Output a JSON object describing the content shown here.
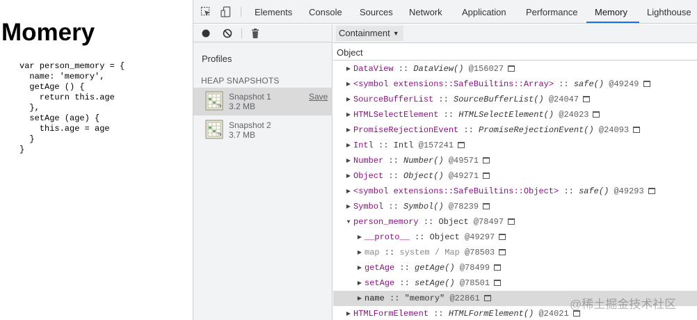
{
  "page": {
    "title": "Momery",
    "code_lines": [
      "var person_memory = {",
      "  name: 'memory',",
      "  getAge () {",
      "    return this.age",
      "  },",
      "  setAge (age) {",
      "    this.age = age",
      "  }",
      "}"
    ]
  },
  "devtools": {
    "toolbar_icons": [
      "inspect-element-icon",
      "device-toolbar-icon"
    ],
    "tabs": [
      {
        "label": "Elements",
        "active": false
      },
      {
        "label": "Console",
        "active": false
      },
      {
        "label": "Sources",
        "active": false
      },
      {
        "label": "Network",
        "active": false
      },
      {
        "label": "Application",
        "active": false
      },
      {
        "label": "Performance",
        "active": false
      },
      {
        "label": "Memory",
        "active": true
      },
      {
        "label": "Lighthouse",
        "active": false
      }
    ],
    "accent_color": "#1a73e8"
  },
  "profiles": {
    "tool_icons": [
      "record-icon",
      "clear-icon",
      "garbage-collect-icon"
    ],
    "heading": "Profiles",
    "section_heading": "HEAP SNAPSHOTS",
    "save_label": "Save",
    "snapshots": [
      {
        "name": "Snapshot 1",
        "size": "3.2 MB",
        "selected": true
      },
      {
        "name": "Snapshot 2",
        "size": "3.7 MB",
        "selected": false
      }
    ]
  },
  "containment": {
    "view_select": "Containment",
    "column_header": "Object",
    "rows": [
      {
        "indent": 0,
        "expanded": false,
        "name": "DataView",
        "sep": " :: ",
        "cls": "DataView()",
        "italic": true,
        "id": "@156027"
      },
      {
        "indent": 0,
        "expanded": false,
        "name": "<symbol extensions::SafeBuiltins::Array>",
        "sep": " :: ",
        "cls": "safe()",
        "italic": true,
        "id": "@49249"
      },
      {
        "indent": 0,
        "expanded": false,
        "name": "SourceBufferList",
        "sep": " :: ",
        "cls": "SourceBufferList()",
        "italic": true,
        "id": "@24047"
      },
      {
        "indent": 0,
        "expanded": false,
        "name": "HTMLSelectElement",
        "sep": " :: ",
        "cls": "HTMLSelectElement()",
        "italic": true,
        "id": "@24023"
      },
      {
        "indent": 0,
        "expanded": false,
        "name": "PromiseRejectionEvent",
        "sep": " :: ",
        "cls": "PromiseRejectionEvent()",
        "italic": true,
        "id": "@24093"
      },
      {
        "indent": 0,
        "expanded": false,
        "name": "Intl",
        "sep": " :: ",
        "cls": "Intl",
        "italic": false,
        "id": "@157241"
      },
      {
        "indent": 0,
        "expanded": false,
        "name": "Number",
        "sep": " :: ",
        "cls": "Number()",
        "italic": true,
        "id": "@49571"
      },
      {
        "indent": 0,
        "expanded": false,
        "name": "Object",
        "sep": " :: ",
        "cls": "Object()",
        "italic": true,
        "id": "@49271"
      },
      {
        "indent": 0,
        "expanded": false,
        "name": "<symbol extensions::SafeBuiltins::Object>",
        "sep": " :: ",
        "cls": "safe()",
        "italic": true,
        "id": "@49293"
      },
      {
        "indent": 0,
        "expanded": false,
        "name": "Symbol",
        "sep": " :: ",
        "cls": "Symbol()",
        "italic": true,
        "id": "@78239"
      },
      {
        "indent": 0,
        "expanded": true,
        "name": "person_memory",
        "sep": " :: ",
        "cls": "Object",
        "italic": false,
        "id": "@78497"
      },
      {
        "indent": 1,
        "expanded": false,
        "name": "__proto__",
        "sep": " :: ",
        "cls": "Object",
        "italic": false,
        "id": "@49297"
      },
      {
        "indent": 1,
        "expanded": false,
        "name": "map",
        "sep": " :: ",
        "cls": "system / Map",
        "italic": false,
        "greyed": true,
        "id": "@78503"
      },
      {
        "indent": 1,
        "expanded": false,
        "name": "getAge",
        "sep": " :: ",
        "cls": "getAge()",
        "italic": true,
        "id": "@78499"
      },
      {
        "indent": 1,
        "expanded": false,
        "name": "setAge",
        "sep": " :: ",
        "cls": "setAge()",
        "italic": true,
        "id": "@78501"
      },
      {
        "indent": 1,
        "expanded": false,
        "name": "name",
        "sep": " :: ",
        "cls": "\"memory\"",
        "italic": false,
        "plain_name": true,
        "id": "@22861",
        "selected": true
      },
      {
        "indent": 0,
        "expanded": false,
        "name": "HTMLFormElement",
        "sep": " :: ",
        "cls": "HTMLFormElement()",
        "italic": true,
        "id": "@24021"
      }
    ]
  },
  "watermark": "@稀土掘金技术社区"
}
